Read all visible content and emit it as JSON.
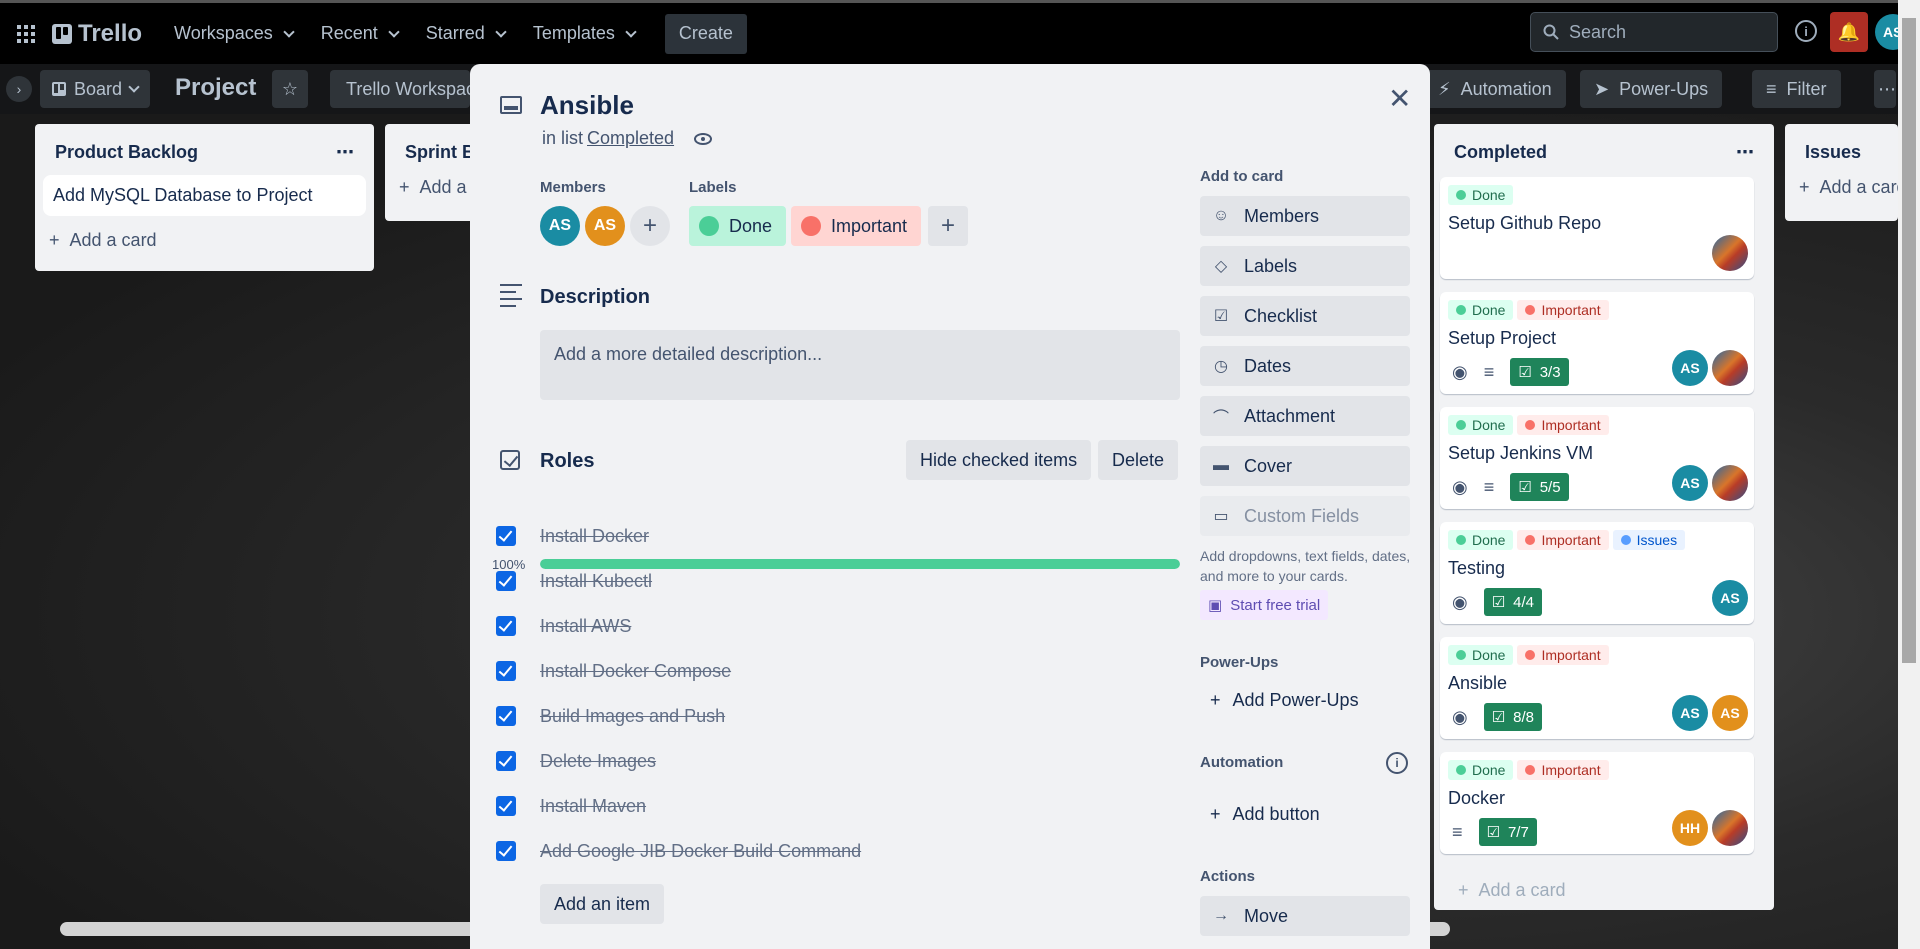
{
  "topbar": {
    "logo": "Trello",
    "nav": [
      "Workspaces",
      "Recent",
      "Starred",
      "Templates"
    ],
    "create": "Create",
    "search_placeholder": "Search",
    "avatar": "AS"
  },
  "boardbar": {
    "view": "Board",
    "title": "Project",
    "workspace": "Trello Workspace",
    "automation": "Automation",
    "powerups": "Power-Ups",
    "filter": "Filter"
  },
  "lists": {
    "backlog": {
      "title": "Product Backlog",
      "card": "Add MySQL Database to Project",
      "add": "Add a card"
    },
    "sprint": {
      "title": "Sprint Backlog",
      "add": "Add a card"
    },
    "completed": {
      "title": "Completed",
      "add": "Add a card",
      "cards": [
        {
          "labels": [
            "Done"
          ],
          "title": "Setup Github Repo"
        },
        {
          "labels": [
            "Done",
            "Important"
          ],
          "title": "Setup Project",
          "checklist": "3/3"
        },
        {
          "labels": [
            "Done",
            "Important"
          ],
          "title": "Setup Jenkins VM",
          "checklist": "5/5"
        },
        {
          "labels": [
            "Done",
            "Important",
            "Issues"
          ],
          "title": "Testing",
          "checklist": "4/4"
        },
        {
          "labels": [
            "Done",
            "Important"
          ],
          "title": "Ansible",
          "checklist": "8/8"
        },
        {
          "labels": [
            "Done",
            "Important"
          ],
          "title": "Docker",
          "checklist": "7/7"
        }
      ],
      "avatars": {
        "as": "AS",
        "hh": "HH"
      }
    },
    "issues": {
      "title": "Issues",
      "add": "Add a card"
    }
  },
  "modal": {
    "title": "Ansible",
    "in_list_prefix": "in list",
    "list_name": "Completed",
    "members_label": "Members",
    "members": [
      "AS",
      "AS"
    ],
    "labels_label": "Labels",
    "labels": [
      {
        "name": "Done",
        "bg": "#baf3db",
        "dot": "#4bce97"
      },
      {
        "name": "Important",
        "bg": "#ffd5d2",
        "dot": "#f87168"
      }
    ],
    "description_title": "Description",
    "description_placeholder": "Add a more detailed description...",
    "checklist": {
      "title": "Roles",
      "hide_btn": "Hide checked items",
      "delete_btn": "Delete",
      "percent": "100%",
      "progress": 1.0,
      "items": [
        "Install Docker",
        "Install Kubectl",
        "Install AWS",
        "Install Docker Compose",
        "Build Images and Push",
        "Delete Images",
        "Install Maven",
        "Add Google JIB Docker Build Command"
      ],
      "add_item": "Add an item"
    },
    "sidebar": {
      "add_to_card": "Add to card",
      "buttons": [
        "Members",
        "Labels",
        "Checklist",
        "Dates",
        "Attachment",
        "Cover",
        "Custom Fields"
      ],
      "custom_note": "Add dropdowns, text fields, dates, and more to your cards.",
      "trial": "Start free trial",
      "powerups_h": "Power-Ups",
      "add_powerups": "Add Power-Ups",
      "automation_h": "Automation",
      "add_button": "Add button",
      "actions_h": "Actions",
      "move": "Move"
    }
  }
}
